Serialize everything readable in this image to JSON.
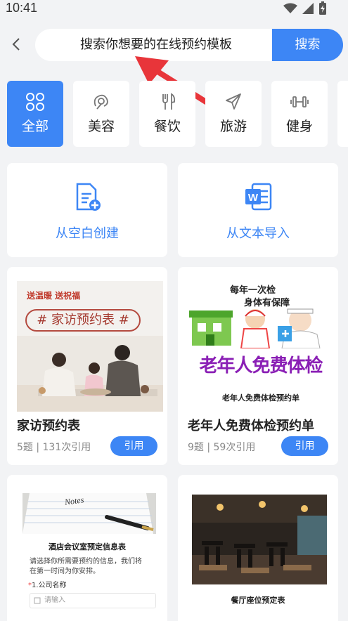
{
  "status": {
    "time": "10:41",
    "icons": [
      "wifi-icon",
      "signal-icon",
      "battery-charging-icon"
    ]
  },
  "search": {
    "value": "搜索你想要的在线预约模板",
    "button": "搜索"
  },
  "categories": [
    {
      "label": "全部",
      "icon": "grid-icon",
      "active": true
    },
    {
      "label": "美容",
      "icon": "beauty-icon",
      "active": false
    },
    {
      "label": "餐饮",
      "icon": "fork-knife-icon",
      "active": false
    },
    {
      "label": "旅游",
      "icon": "airplane-icon",
      "active": false
    },
    {
      "label": "健身",
      "icon": "dumbbell-icon",
      "active": false
    }
  ],
  "create": [
    {
      "label": "从空白创建",
      "icon": "new-document-icon"
    },
    {
      "label": "从文本导入",
      "icon": "word-document-icon"
    }
  ],
  "templates": [
    {
      "title": "家访预约表",
      "meta": "5题 | 131次引用",
      "button": "引用",
      "thumb": {
        "tag": "送温暖 送祝福",
        "banner": "# 家访预约表 #"
      }
    },
    {
      "title": "老年人免费体检预约单",
      "meta": "9题 | 59次引用",
      "button": "引用",
      "thumb": {
        "slogan1": "每年一次检",
        "slogan2": "身体有保障",
        "hospital": "Hospital",
        "headline": "老年人免费体检",
        "caption": "老年人免费体检预约单"
      }
    },
    {
      "thumb": {
        "notes": "Notes",
        "heading": "酒店会议室预定信息表",
        "desc1": "请选择你所需要预约的信息，我们将",
        "desc2": "在第一时间为你安排。",
        "q1": "1.公司名称",
        "input": "请输入"
      }
    },
    {
      "thumb": {
        "caption": "餐厅座位预定表"
      }
    }
  ],
  "colors": {
    "accent": "#3d86f5",
    "background": "#f2f3f5",
    "purple": "#8a1fb5"
  }
}
